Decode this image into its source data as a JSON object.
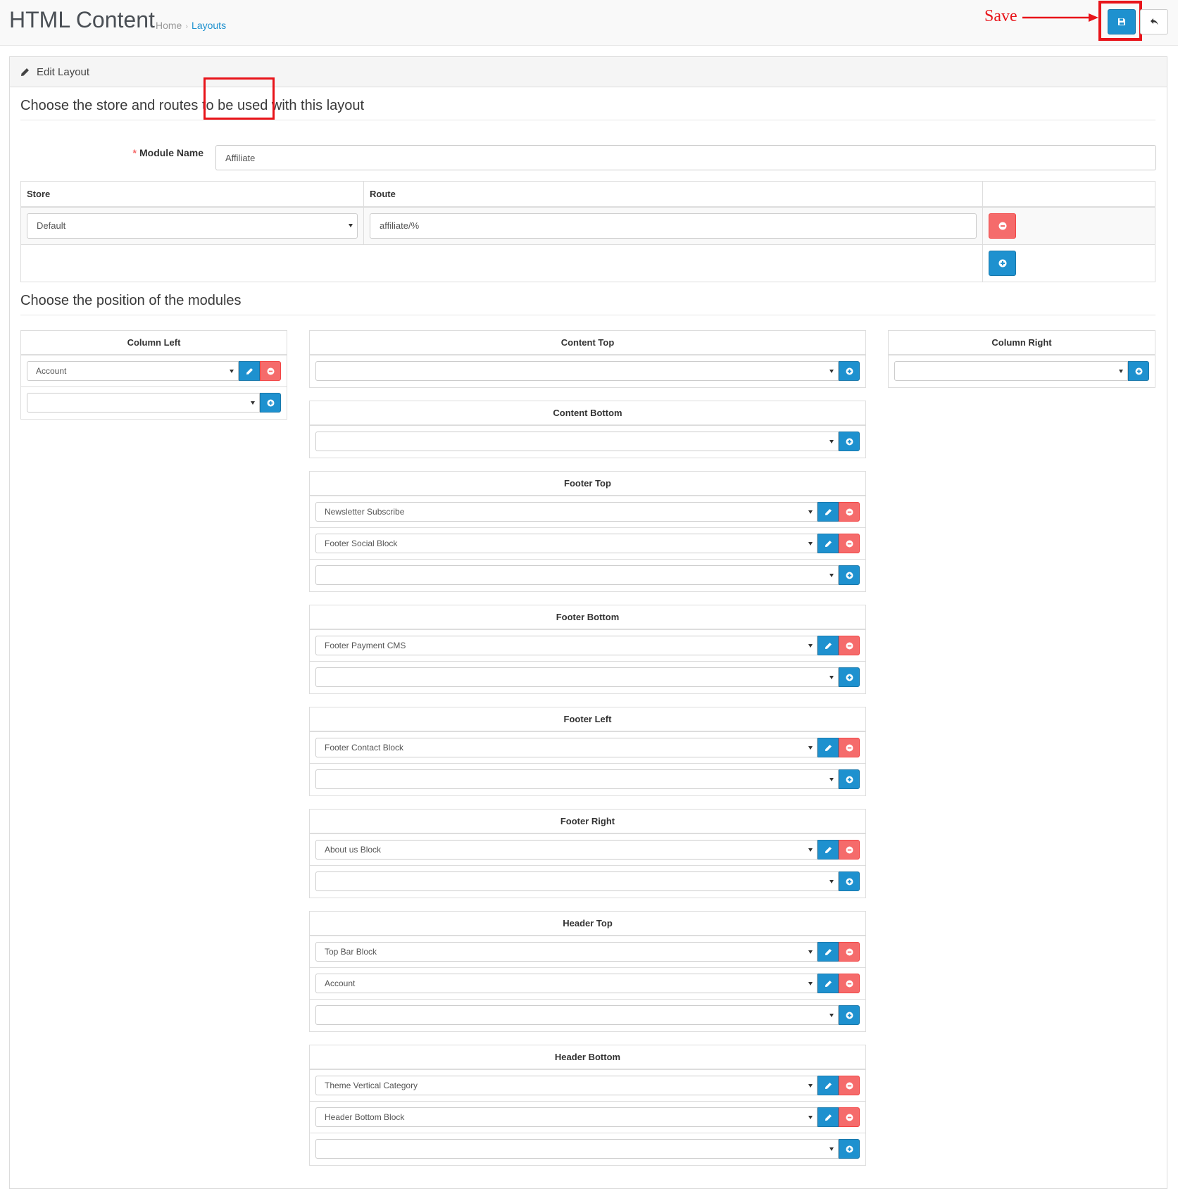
{
  "header": {
    "title": "HTML Content",
    "breadcrumb": {
      "home": "Home",
      "separator": "›",
      "current": "Layouts"
    }
  },
  "annotation": {
    "label": "Save",
    "color": "#e8141a"
  },
  "toolbar": {
    "save_icon": "save-icon",
    "back_icon": "reply-icon"
  },
  "panel": {
    "heading": "Edit Layout",
    "legend_routes": "Choose the store and routes to be used with this layout",
    "legend_positions": "Choose the position of the modules"
  },
  "form": {
    "module_name_label": "Module Name",
    "required_mark": "*",
    "module_name_value": "Affiliate"
  },
  "route_table": {
    "headers": {
      "store": "Store",
      "route": "Route",
      "action": ""
    },
    "rows": [
      {
        "store": "Default",
        "route": "affiliate/%"
      }
    ]
  },
  "positions": {
    "column_left": {
      "title": "Column Left",
      "modules": [
        "Account"
      ]
    },
    "content_top": {
      "title": "Content Top",
      "modules": []
    },
    "column_right": {
      "title": "Column Right",
      "modules": []
    },
    "content_bottom": {
      "title": "Content Bottom",
      "modules": []
    },
    "footer_top": {
      "title": "Footer Top",
      "modules": [
        "Newsletter Subscribe",
        "Footer Social Block"
      ]
    },
    "footer_bottom": {
      "title": "Footer Bottom",
      "modules": [
        "Footer Payment CMS"
      ]
    },
    "footer_left": {
      "title": "Footer Left",
      "modules": [
        "Footer Contact Block"
      ]
    },
    "footer_right": {
      "title": "Footer Right",
      "modules": [
        "About us Block"
      ]
    },
    "header_top": {
      "title": "Header Top",
      "modules": [
        "Top Bar Block",
        "Account"
      ]
    },
    "header_bottom": {
      "title": "Header Bottom",
      "modules": [
        "Theme Vertical Category",
        "Header Bottom Block"
      ]
    }
  },
  "colors": {
    "primary": "#1e91cf",
    "danger": "#f56b6b",
    "highlight": "#e8141a"
  }
}
